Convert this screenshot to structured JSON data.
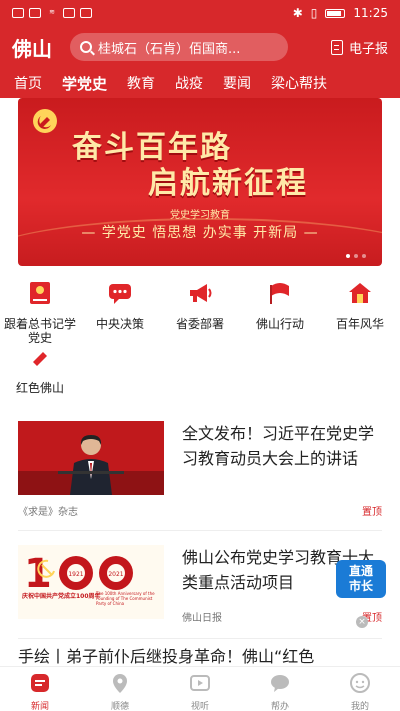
{
  "status_bar": {
    "time": "11:25"
  },
  "header": {
    "logo": "佛山",
    "search_placeholder": "桂城石（石肯）佰国商...",
    "epaper_label": "电子报"
  },
  "nav": {
    "tabs": [
      {
        "label": "首页"
      },
      {
        "label": "学党史"
      },
      {
        "label": "教育"
      },
      {
        "label": "战疫"
      },
      {
        "label": "要闻"
      },
      {
        "label": "梁心帮扶"
      }
    ],
    "active_index": 1
  },
  "banner": {
    "title_line1": "奋斗百年路",
    "title_line2": "启航新征程",
    "subtitle": "党史学习教育",
    "slogan": "— 学党史  悟思想  办实事  开新局 —",
    "page_count": 3,
    "active_page": 0
  },
  "categories": [
    {
      "label": "跟着总书记学党史",
      "icon": "book-party-icon"
    },
    {
      "label": "中央决策",
      "icon": "chat-bubble-icon"
    },
    {
      "label": "省委部署",
      "icon": "megaphone-icon"
    },
    {
      "label": "佛山行动",
      "icon": "flag-icon"
    },
    {
      "label": "百年风华",
      "icon": "house-icon"
    },
    {
      "label": "红色佛山",
      "icon": "party-emblem-icon"
    }
  ],
  "articles": [
    {
      "title": "全文发布！习近平在党史学习教育动员大会上的讲话",
      "source": "《求是》杂志",
      "tag": "置顶"
    },
    {
      "title": "佛山公布党史学习教育十大类重点活动项目",
      "source": "佛山日报",
      "tag": "置顶",
      "image_caption": "庆祝中国共产党成立100周年",
      "image_caption_en": "The 100th Anniversary of the Founding of The Communist Party of China",
      "image_years": [
        "1921",
        "2021"
      ]
    },
    {
      "title": "手绘丨弟子前仆后继投身革命！佛山“红色"
    }
  ],
  "float_badge": {
    "label_line1": "直通",
    "label_line2": "市长",
    "close": "×"
  },
  "tabbar": {
    "tabs": [
      {
        "label": "新闻",
        "icon": "news-icon"
      },
      {
        "label": "顺德",
        "icon": "location-icon"
      },
      {
        "label": "视听",
        "icon": "play-icon"
      },
      {
        "label": "帮办",
        "icon": "chat-icon"
      },
      {
        "label": "我的",
        "icon": "user-icon"
      }
    ],
    "active_index": 0
  },
  "colors": {
    "brand_red": "#d7282b",
    "banner_gold": "#ffe9a8",
    "badge_blue": "#1b7bd6"
  }
}
